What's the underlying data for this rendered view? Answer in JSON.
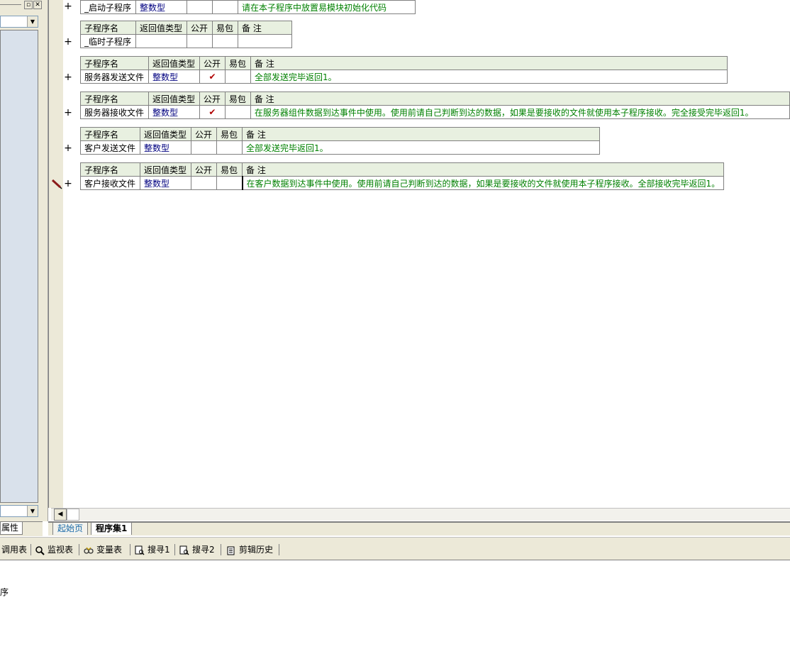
{
  "panel": {
    "props_tab": "属性"
  },
  "columns": [
    "子程序名",
    "返回值类型",
    "公开",
    "易包",
    "备 注"
  ],
  "subs": [
    {
      "name": "_启动子程序",
      "type": "整数型",
      "public": false,
      "remark": "请在本子程序中放置易模块初始化代码"
    },
    {
      "name": "_临时子程序",
      "type": "",
      "public": false,
      "remark": ""
    },
    {
      "name": "服务器发送文件",
      "type": "整数型",
      "public": true,
      "remark": "全部发送完毕返回1。"
    },
    {
      "name": "服务器接收文件",
      "type": "整数型",
      "public": true,
      "remark": "在服务器组件数据到达事件中使用。使用前请自己判断到达的数据，如果是要接收的文件就使用本子程序接收。完全接受完毕返回1。"
    },
    {
      "name": "客户发送文件",
      "type": "整数型",
      "public": false,
      "remark": "全部发送完毕返回1。"
    },
    {
      "name": "客户接收文件",
      "type": "整数型",
      "public": false,
      "remark": "在客户数据到达事件中使用。使用前请自己判断到达的数据，如果是要接收的文件就使用本子程序接收。全部接收完毕返回1。"
    }
  ],
  "check_mark": "✔",
  "plus_sign": "+",
  "page_tabs": {
    "start": "起始页",
    "active": "程序集1"
  },
  "toolbar": {
    "call_table": "调用表",
    "watch_table": "监视表",
    "var_table": "变量表",
    "search1": "搜寻1",
    "search2": "搜寻2",
    "clip_history": "剪辑历史"
  },
  "output": {
    "line1": "序"
  },
  "colors": {
    "header_bg": "#e8f0e0",
    "type_text": "#000080",
    "remark_text": "#008000",
    "check_mark": "#b00000",
    "panel_bg": "#ece9d8",
    "tree_bg": "#d9e1eb"
  }
}
